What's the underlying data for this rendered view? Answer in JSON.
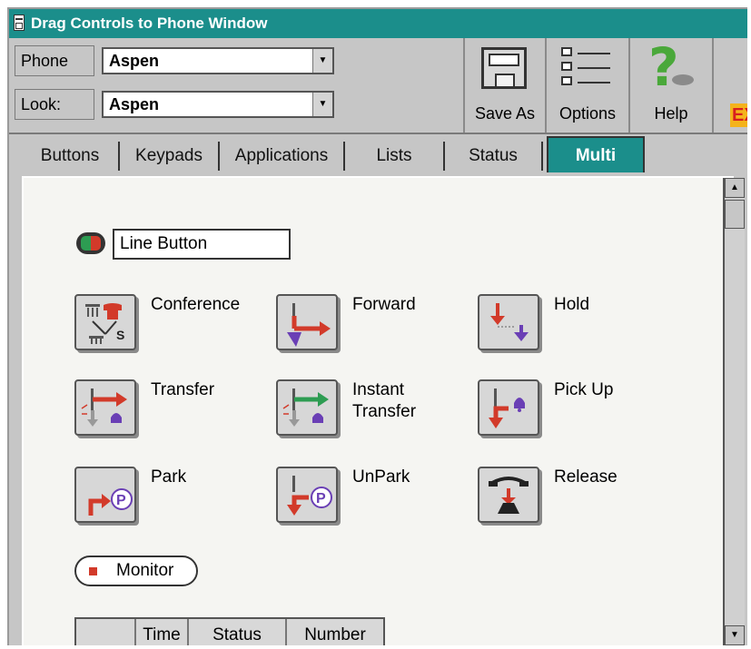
{
  "window": {
    "title": "Drag Controls to Phone Window"
  },
  "fields": {
    "phone": {
      "label": "Phone",
      "value": "Aspen"
    },
    "look": {
      "label": "Look:",
      "value": "Aspen"
    }
  },
  "toolbar": {
    "save_as_label": "Save As",
    "options_label": "Options",
    "help_label": "Help",
    "exit_fragment": "EX"
  },
  "tabs": [
    {
      "label": "Buttons"
    },
    {
      "label": "Keypads"
    },
    {
      "label": "Applications"
    },
    {
      "label": "Lists"
    },
    {
      "label": "Status"
    },
    {
      "label": "Multi",
      "active": true
    }
  ],
  "panel": {
    "line_button_label": "Line Button",
    "controls": [
      {
        "label": "Conference",
        "icon": "conference-icon"
      },
      {
        "label": "Forward",
        "icon": "forward-icon"
      },
      {
        "label": "Hold",
        "icon": "hold-icon"
      },
      {
        "label": "Transfer",
        "icon": "transfer-icon"
      },
      {
        "label": "Instant",
        "label2": "Transfer",
        "icon": "instant-transfer-icon"
      },
      {
        "label": "Pick Up",
        "icon": "pick-up-icon"
      },
      {
        "label": "Park",
        "icon": "park-icon"
      },
      {
        "label": "UnPark",
        "icon": "unpark-icon"
      },
      {
        "label": "Release",
        "icon": "release-icon"
      }
    ],
    "monitor_label": "Monitor",
    "table_headers": [
      "",
      "Time",
      "Status",
      "Number"
    ]
  },
  "colors": {
    "titlebar": "#1b8e8b",
    "active_tab": "#1b8e8b",
    "accent_red": "#d23a2a",
    "accent_purple": "#6a3fb5",
    "accent_green": "#2d9c52"
  }
}
